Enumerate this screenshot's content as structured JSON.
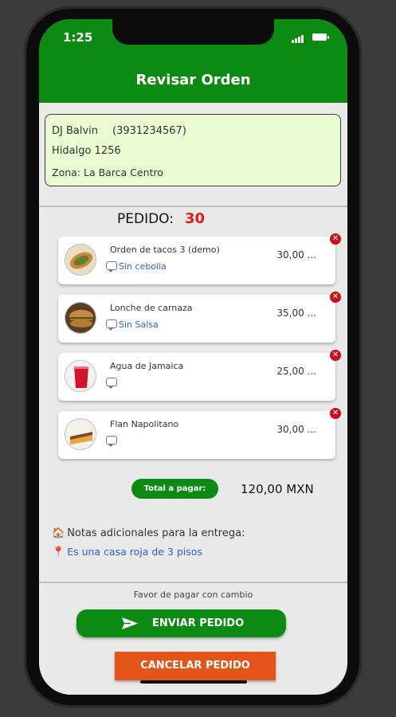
{
  "status_bar": {
    "time": "1:25"
  },
  "header": {
    "title": "Revisar Orden"
  },
  "customer": {
    "name": "DJ Balvin",
    "phone": "(3931234567)",
    "address": "Hidalgo 1256",
    "zone": "Zona: La Barca Centro"
  },
  "order": {
    "label": "PEDIDO:",
    "number": "30"
  },
  "items": [
    {
      "name": "Orden de tacos 3 (demo)",
      "note": "Sin cebolla",
      "price": "30,00 ...",
      "icon": "tacos-image"
    },
    {
      "name": "Lonche de carnaza",
      "note": "Sin Salsa",
      "price": "35,00 ...",
      "icon": "sandwich-image"
    },
    {
      "name": "Agua de Jamaica",
      "note": "",
      "price": "25,00 ...",
      "icon": "drink-image"
    },
    {
      "name": "Flan Napolitano",
      "note": "",
      "price": "30,00 ...",
      "icon": "flan-image"
    }
  ],
  "total": {
    "label": "Total a pagar:",
    "value": "120,00 MXN"
  },
  "notes": {
    "label": "Notas adicionales para la entrega:",
    "text": "Es una casa roja de 3 pisos"
  },
  "payment_note": "Favor de pagar con cambio",
  "buttons": {
    "send": "ENVIAR PEDIDO",
    "cancel": "CANCELAR PEDIDO"
  },
  "colors": {
    "primary_green": "#0d8a12",
    "cancel_orange": "#e3541a",
    "remove_red": "#c8101d",
    "accent_red": "#e21b1b",
    "link_blue": "#2a5fd6"
  }
}
